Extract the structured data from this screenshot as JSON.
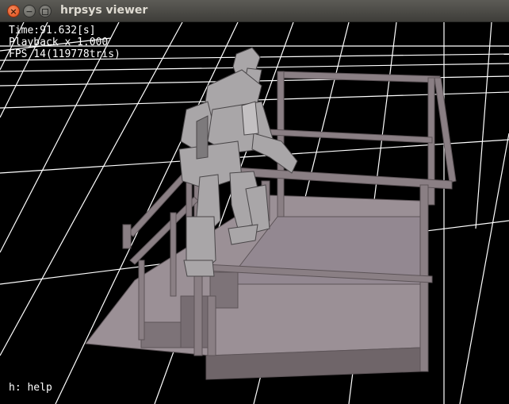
{
  "window": {
    "title": "hrpsys viewer",
    "buttons": {
      "close": "×",
      "minimize": "−",
      "maximize": ""
    }
  },
  "overlay": {
    "time": "Time:91.632[s]",
    "playback": "Playback x 1.000",
    "fps": "FPS 14(119778tris)",
    "help": "h: help"
  },
  "scene": {
    "background": "#000000",
    "grid_color": "#ffffff",
    "structure_color": "#8a7f84",
    "robot_color": "#a9a6a8"
  }
}
